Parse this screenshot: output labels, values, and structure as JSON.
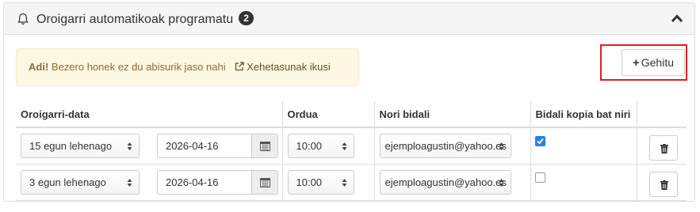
{
  "panel": {
    "title": "Oroigarri automatikoak programatu",
    "badge": "2"
  },
  "alert": {
    "strong": "Adi!",
    "text": "Bezero honek ez du abisurik jaso nahi",
    "link": "Xehetasunak ikusi"
  },
  "add_button": {
    "plus": "+",
    "label": "Gehitu"
  },
  "table": {
    "headers": [
      "Oroigarri-data",
      "Ordua",
      "Nori bidali",
      "Bidali kopia bat niri"
    ],
    "rows": [
      {
        "offset": "15 egun lehenago",
        "date": "2026-04-16",
        "time": "10:00",
        "recipient": "ejemploagustin@yahoo.es",
        "copy_to_me": true
      },
      {
        "offset": "3 egun lehenago",
        "date": "2026-04-16",
        "time": "10:00",
        "recipient": "ejemploagustin@yahoo.es",
        "copy_to_me": false
      }
    ]
  },
  "icons": {
    "header": "bell-icon",
    "collapse": "chevron-up-icon",
    "alert_link": "external-link-icon",
    "date_picker": "calendar-icon",
    "delete": "trash-icon",
    "select": "updown-arrows-icon"
  },
  "colors": {
    "alert_bg": "#fcf8e3",
    "alert_text": "#8a6d3b",
    "highlight_border": "#e0201f",
    "checkbox_checked": "#2d7ce6",
    "badge_bg": "#333333"
  }
}
